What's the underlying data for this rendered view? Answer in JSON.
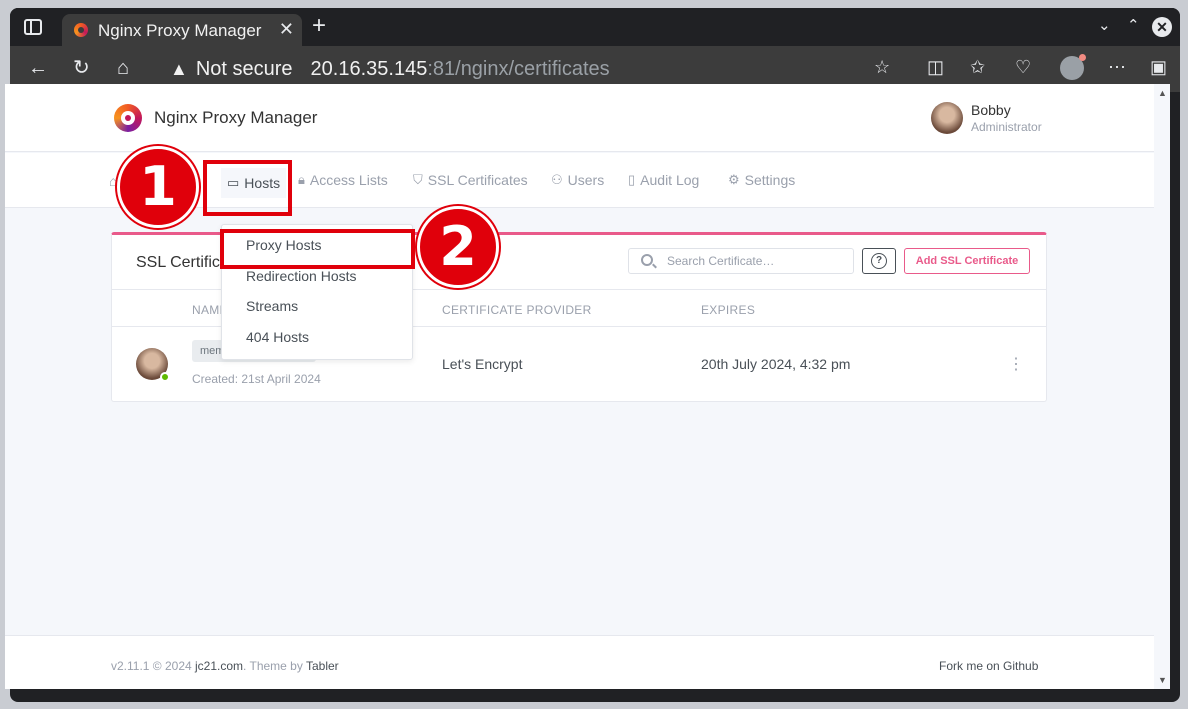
{
  "browser": {
    "tab_title": "Nginx Proxy Manager",
    "security_warning": "Not secure",
    "url_host": "20.16.35.145",
    "url_path": ":81/nginx/certificates"
  },
  "header": {
    "brand": "Nginx Proxy Manager",
    "user_name": "Bobby",
    "user_role": "Administrator"
  },
  "nav": {
    "items": [
      {
        "label": "Hosts",
        "icon": "monitor-icon"
      },
      {
        "label": "Access Lists",
        "icon": "lock-icon"
      },
      {
        "label": "SSL Certificates",
        "icon": "shield-icon"
      },
      {
        "label": "Users",
        "icon": "users-icon"
      },
      {
        "label": "Audit Log",
        "icon": "book-icon"
      },
      {
        "label": "Settings",
        "icon": "gear-icon"
      }
    ]
  },
  "dropdown": {
    "items": [
      "Proxy Hosts",
      "Redirection Hosts",
      "Streams",
      "404 Hosts"
    ]
  },
  "card": {
    "title": "SSL Certific",
    "search_placeholder": "Search Certificate…",
    "help_label": "?",
    "add_label": "Add SSL Certificate",
    "columns": [
      "NAME",
      "CERTIFICATE PROVIDER",
      "EXPIRES"
    ],
    "rows": [
      {
        "domain": "mem",
        "created": "Created: 21st April 2024",
        "provider": "Let's Encrypt",
        "expires": "20th July 2024, 4:32 pm"
      }
    ]
  },
  "annotations": {
    "step1": "1",
    "step2": "2",
    "color": "#e0000b"
  },
  "footer": {
    "version": "v2.11.1 © 2024 ",
    "author_link": "jc21.com",
    "theme_text": ". Theme by ",
    "theme_link": "Tabler",
    "github": "Fork me on Github"
  }
}
